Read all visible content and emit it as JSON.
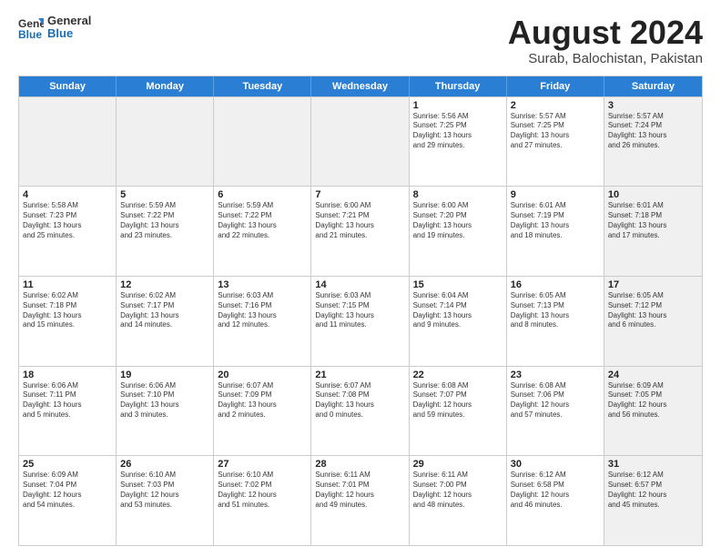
{
  "header": {
    "logo_general": "General",
    "logo_blue": "Blue",
    "month_title": "August 2024",
    "subtitle": "Surab, Balochistan, Pakistan"
  },
  "weekdays": [
    "Sunday",
    "Monday",
    "Tuesday",
    "Wednesday",
    "Thursday",
    "Friday",
    "Saturday"
  ],
  "rows": [
    [
      {
        "day": "",
        "text": "",
        "shaded": true
      },
      {
        "day": "",
        "text": "",
        "shaded": true
      },
      {
        "day": "",
        "text": "",
        "shaded": true
      },
      {
        "day": "",
        "text": "",
        "shaded": true
      },
      {
        "day": "1",
        "text": "Sunrise: 5:56 AM\nSunset: 7:25 PM\nDaylight: 13 hours\nand 29 minutes.",
        "shaded": false
      },
      {
        "day": "2",
        "text": "Sunrise: 5:57 AM\nSunset: 7:25 PM\nDaylight: 13 hours\nand 27 minutes.",
        "shaded": false
      },
      {
        "day": "3",
        "text": "Sunrise: 5:57 AM\nSunset: 7:24 PM\nDaylight: 13 hours\nand 26 minutes.",
        "shaded": true
      }
    ],
    [
      {
        "day": "4",
        "text": "Sunrise: 5:58 AM\nSunset: 7:23 PM\nDaylight: 13 hours\nand 25 minutes.",
        "shaded": false
      },
      {
        "day": "5",
        "text": "Sunrise: 5:59 AM\nSunset: 7:22 PM\nDaylight: 13 hours\nand 23 minutes.",
        "shaded": false
      },
      {
        "day": "6",
        "text": "Sunrise: 5:59 AM\nSunset: 7:22 PM\nDaylight: 13 hours\nand 22 minutes.",
        "shaded": false
      },
      {
        "day": "7",
        "text": "Sunrise: 6:00 AM\nSunset: 7:21 PM\nDaylight: 13 hours\nand 21 minutes.",
        "shaded": false
      },
      {
        "day": "8",
        "text": "Sunrise: 6:00 AM\nSunset: 7:20 PM\nDaylight: 13 hours\nand 19 minutes.",
        "shaded": false
      },
      {
        "day": "9",
        "text": "Sunrise: 6:01 AM\nSunset: 7:19 PM\nDaylight: 13 hours\nand 18 minutes.",
        "shaded": false
      },
      {
        "day": "10",
        "text": "Sunrise: 6:01 AM\nSunset: 7:18 PM\nDaylight: 13 hours\nand 17 minutes.",
        "shaded": true
      }
    ],
    [
      {
        "day": "11",
        "text": "Sunrise: 6:02 AM\nSunset: 7:18 PM\nDaylight: 13 hours\nand 15 minutes.",
        "shaded": false
      },
      {
        "day": "12",
        "text": "Sunrise: 6:02 AM\nSunset: 7:17 PM\nDaylight: 13 hours\nand 14 minutes.",
        "shaded": false
      },
      {
        "day": "13",
        "text": "Sunrise: 6:03 AM\nSunset: 7:16 PM\nDaylight: 13 hours\nand 12 minutes.",
        "shaded": false
      },
      {
        "day": "14",
        "text": "Sunrise: 6:03 AM\nSunset: 7:15 PM\nDaylight: 13 hours\nand 11 minutes.",
        "shaded": false
      },
      {
        "day": "15",
        "text": "Sunrise: 6:04 AM\nSunset: 7:14 PM\nDaylight: 13 hours\nand 9 minutes.",
        "shaded": false
      },
      {
        "day": "16",
        "text": "Sunrise: 6:05 AM\nSunset: 7:13 PM\nDaylight: 13 hours\nand 8 minutes.",
        "shaded": false
      },
      {
        "day": "17",
        "text": "Sunrise: 6:05 AM\nSunset: 7:12 PM\nDaylight: 13 hours\nand 6 minutes.",
        "shaded": true
      }
    ],
    [
      {
        "day": "18",
        "text": "Sunrise: 6:06 AM\nSunset: 7:11 PM\nDaylight: 13 hours\nand 5 minutes.",
        "shaded": false
      },
      {
        "day": "19",
        "text": "Sunrise: 6:06 AM\nSunset: 7:10 PM\nDaylight: 13 hours\nand 3 minutes.",
        "shaded": false
      },
      {
        "day": "20",
        "text": "Sunrise: 6:07 AM\nSunset: 7:09 PM\nDaylight: 13 hours\nand 2 minutes.",
        "shaded": false
      },
      {
        "day": "21",
        "text": "Sunrise: 6:07 AM\nSunset: 7:08 PM\nDaylight: 13 hours\nand 0 minutes.",
        "shaded": false
      },
      {
        "day": "22",
        "text": "Sunrise: 6:08 AM\nSunset: 7:07 PM\nDaylight: 12 hours\nand 59 minutes.",
        "shaded": false
      },
      {
        "day": "23",
        "text": "Sunrise: 6:08 AM\nSunset: 7:06 PM\nDaylight: 12 hours\nand 57 minutes.",
        "shaded": false
      },
      {
        "day": "24",
        "text": "Sunrise: 6:09 AM\nSunset: 7:05 PM\nDaylight: 12 hours\nand 56 minutes.",
        "shaded": true
      }
    ],
    [
      {
        "day": "25",
        "text": "Sunrise: 6:09 AM\nSunset: 7:04 PM\nDaylight: 12 hours\nand 54 minutes.",
        "shaded": false
      },
      {
        "day": "26",
        "text": "Sunrise: 6:10 AM\nSunset: 7:03 PM\nDaylight: 12 hours\nand 53 minutes.",
        "shaded": false
      },
      {
        "day": "27",
        "text": "Sunrise: 6:10 AM\nSunset: 7:02 PM\nDaylight: 12 hours\nand 51 minutes.",
        "shaded": false
      },
      {
        "day": "28",
        "text": "Sunrise: 6:11 AM\nSunset: 7:01 PM\nDaylight: 12 hours\nand 49 minutes.",
        "shaded": false
      },
      {
        "day": "29",
        "text": "Sunrise: 6:11 AM\nSunset: 7:00 PM\nDaylight: 12 hours\nand 48 minutes.",
        "shaded": false
      },
      {
        "day": "30",
        "text": "Sunrise: 6:12 AM\nSunset: 6:58 PM\nDaylight: 12 hours\nand 46 minutes.",
        "shaded": false
      },
      {
        "day": "31",
        "text": "Sunrise: 6:12 AM\nSunset: 6:57 PM\nDaylight: 12 hours\nand 45 minutes.",
        "shaded": true
      }
    ]
  ]
}
